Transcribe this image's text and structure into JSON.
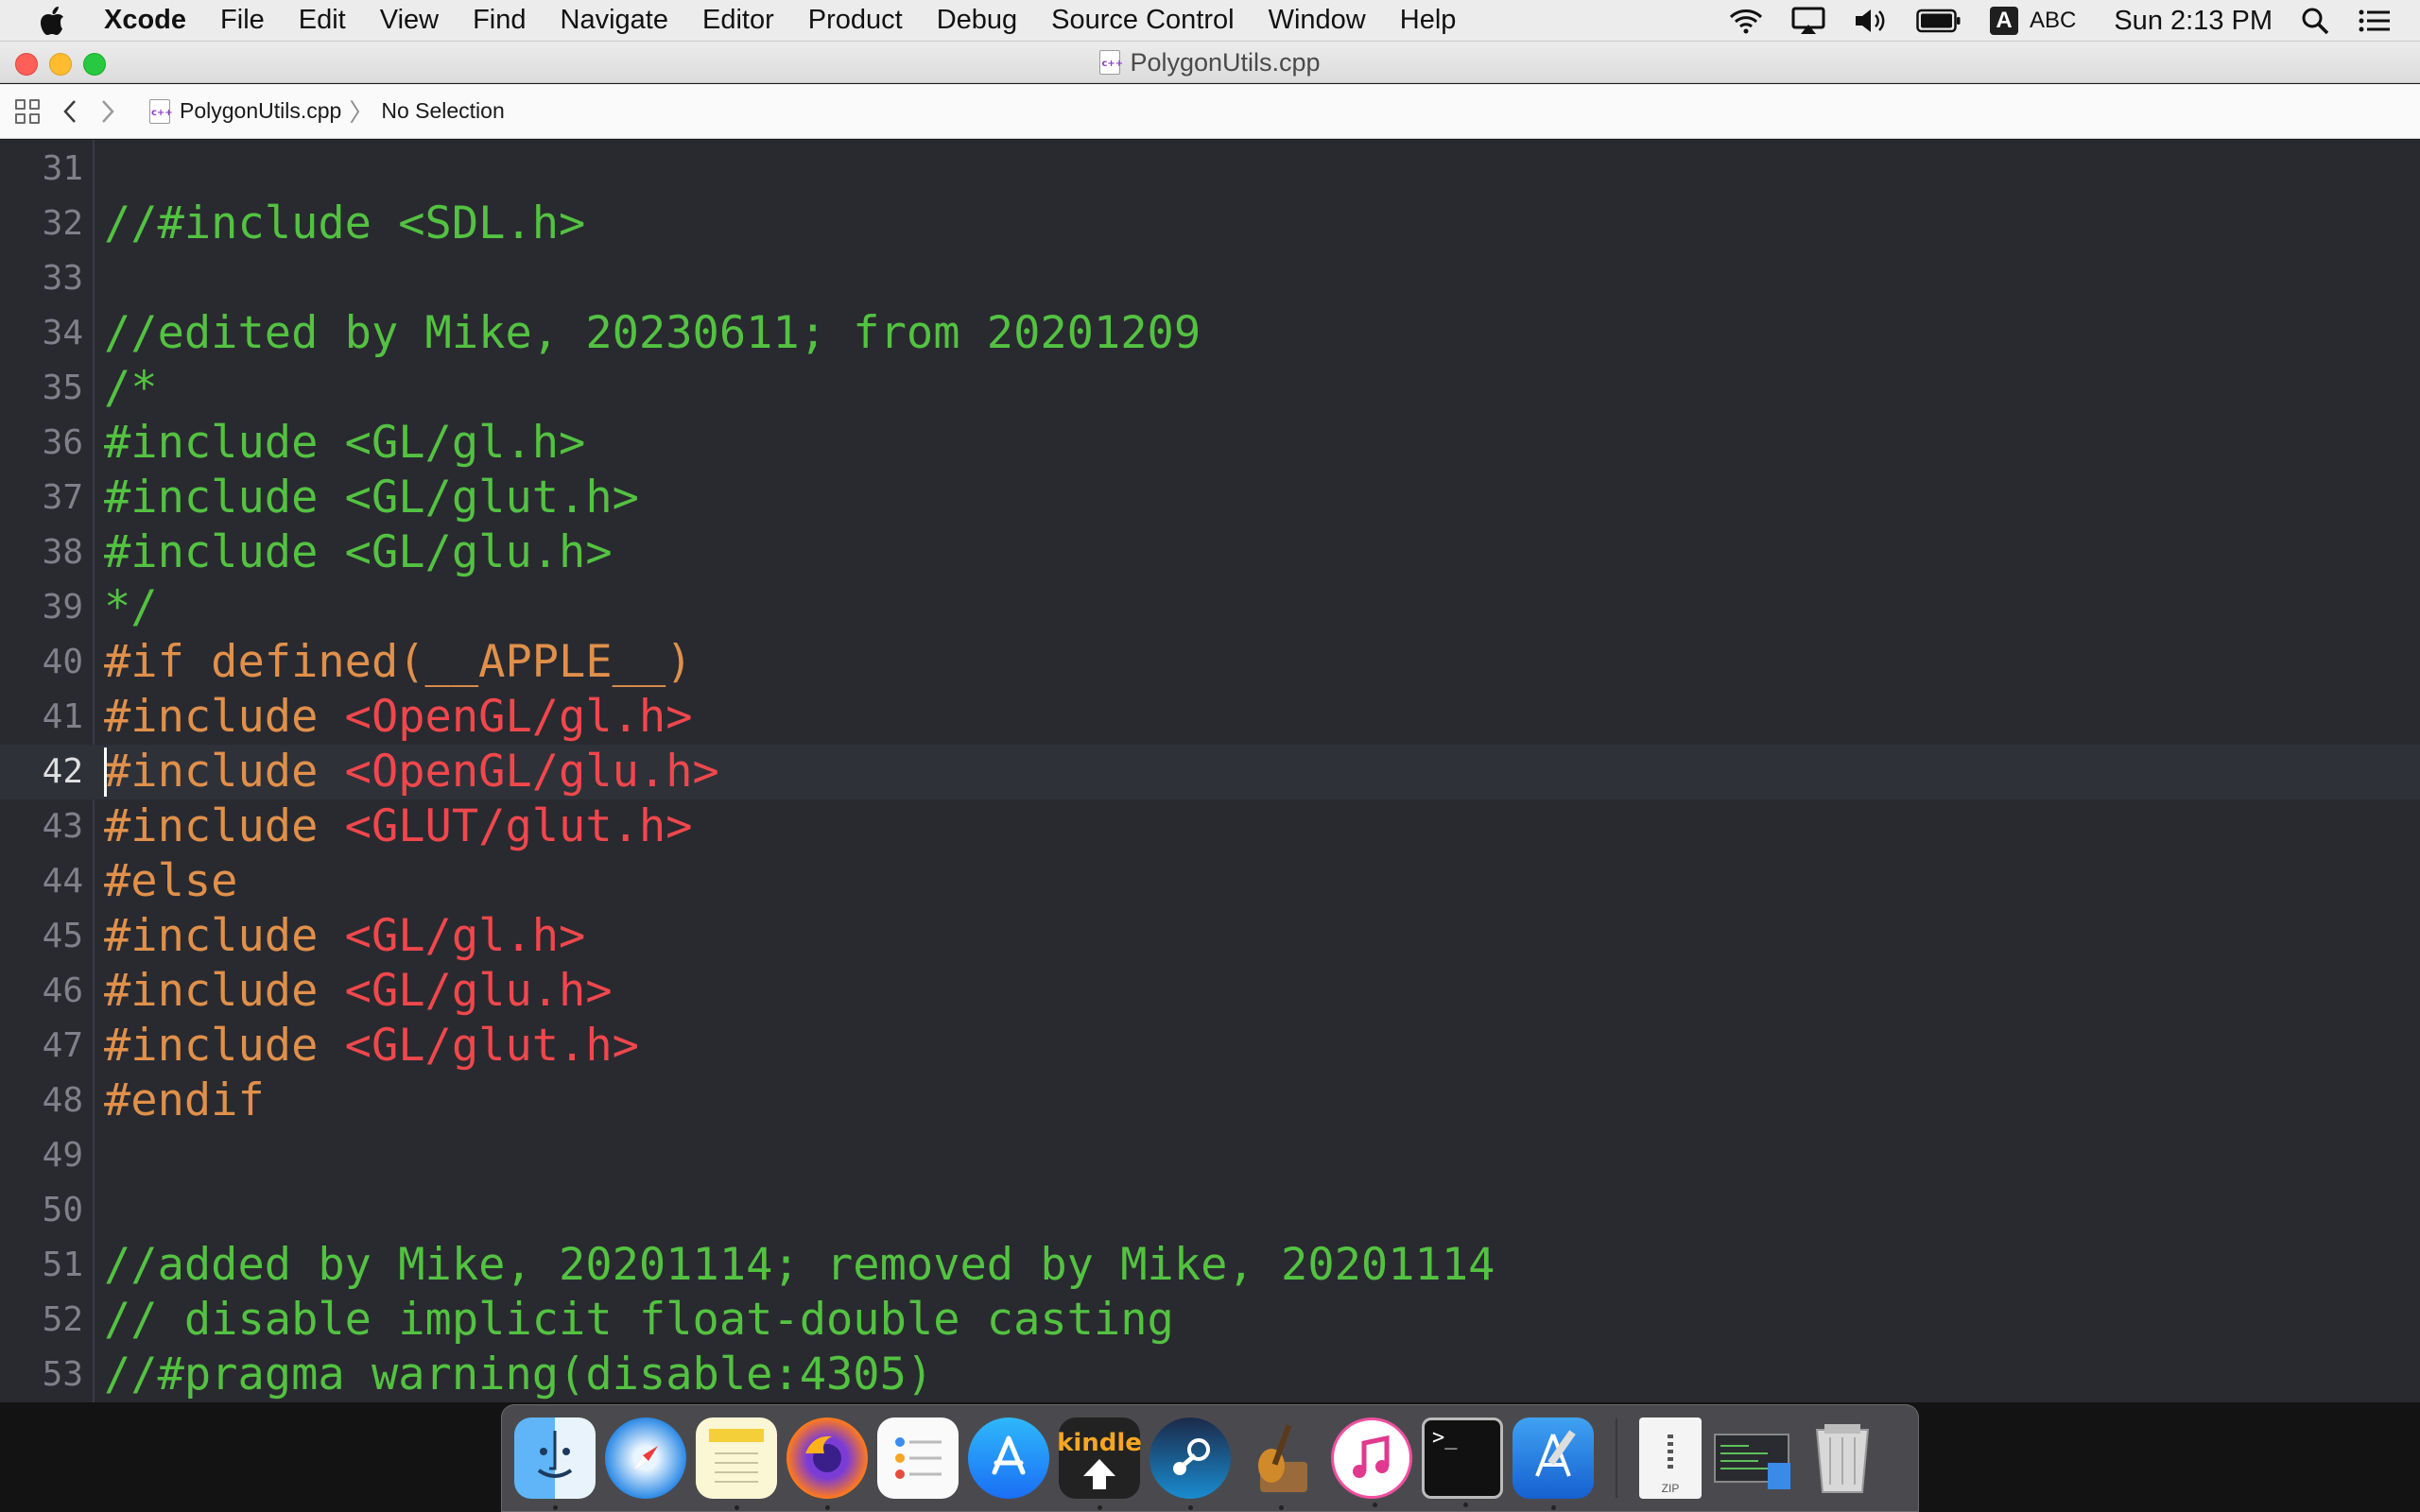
{
  "menubar": {
    "app_name": "Xcode",
    "items": [
      "File",
      "Edit",
      "View",
      "Find",
      "Navigate",
      "Editor",
      "Product",
      "Debug",
      "Source Control",
      "Window",
      "Help"
    ],
    "input_source_badge": "A",
    "input_source_label": "ABC",
    "clock": "Sun 2:13 PM"
  },
  "window": {
    "title": "PolygonUtils.cpp"
  },
  "jumpbar": {
    "file": "PolygonUtils.cpp",
    "selection": "No Selection"
  },
  "editor": {
    "current_line": "42",
    "lines": [
      {
        "num": "31",
        "segments": []
      },
      {
        "num": "32",
        "segments": [
          {
            "t": "//#include <SDL.h>",
            "k": "comment"
          }
        ]
      },
      {
        "num": "33",
        "segments": []
      },
      {
        "num": "34",
        "segments": [
          {
            "t": "//edited by Mike, 20230611; from 20201209",
            "k": "comment"
          }
        ]
      },
      {
        "num": "35",
        "segments": [
          {
            "t": "/*",
            "k": "comment"
          }
        ]
      },
      {
        "num": "36",
        "segments": [
          {
            "t": "#include <GL/gl.h>",
            "k": "comment"
          }
        ]
      },
      {
        "num": "37",
        "segments": [
          {
            "t": "#include <GL/glut.h>",
            "k": "comment"
          }
        ]
      },
      {
        "num": "38",
        "segments": [
          {
            "t": "#include <GL/glu.h>",
            "k": "comment"
          }
        ]
      },
      {
        "num": "39",
        "segments": [
          {
            "t": "*/",
            "k": "comment"
          }
        ]
      },
      {
        "num": "40",
        "segments": [
          {
            "t": "#if defined(__APPLE__)",
            "k": "pp"
          }
        ]
      },
      {
        "num": "41",
        "segments": [
          {
            "t": "#include ",
            "k": "pp"
          },
          {
            "t": "<OpenGL/gl.h>",
            "k": "str"
          }
        ]
      },
      {
        "num": "42",
        "segments": [
          {
            "t": "#include ",
            "k": "pp"
          },
          {
            "t": "<OpenGL/glu.h>",
            "k": "str"
          }
        ]
      },
      {
        "num": "43",
        "segments": [
          {
            "t": "#include ",
            "k": "pp"
          },
          {
            "t": "<GLUT/glut.h>",
            "k": "str"
          }
        ]
      },
      {
        "num": "44",
        "segments": [
          {
            "t": "#else",
            "k": "pp"
          }
        ]
      },
      {
        "num": "45",
        "segments": [
          {
            "t": "#include ",
            "k": "pp"
          },
          {
            "t": "<GL/gl.h>",
            "k": "str"
          }
        ]
      },
      {
        "num": "46",
        "segments": [
          {
            "t": "#include ",
            "k": "pp"
          },
          {
            "t": "<GL/glu.h>",
            "k": "str"
          }
        ]
      },
      {
        "num": "47",
        "segments": [
          {
            "t": "#include ",
            "k": "pp"
          },
          {
            "t": "<GL/glut.h>",
            "k": "str"
          }
        ]
      },
      {
        "num": "48",
        "segments": [
          {
            "t": "#endif",
            "k": "pp"
          }
        ]
      },
      {
        "num": "49",
        "segments": []
      },
      {
        "num": "50",
        "segments": []
      },
      {
        "num": "51",
        "segments": [
          {
            "t": "//added by Mike, 20201114; removed by Mike, 20201114",
            "k": "comment"
          }
        ]
      },
      {
        "num": "52",
        "segments": [
          {
            "t": "// disable implicit float-double casting",
            "k": "comment"
          }
        ]
      },
      {
        "num": "53",
        "segments": [
          {
            "t": "//#pragma warning(disable:4305)",
            "k": "comment"
          }
        ]
      }
    ]
  },
  "dock": {
    "apps": [
      {
        "icon": "finder-icon",
        "running": true
      },
      {
        "icon": "safari-icon",
        "running": false
      },
      {
        "icon": "notes-icon",
        "running": true
      },
      {
        "icon": "firefox-icon",
        "running": true
      },
      {
        "icon": "reminders-icon",
        "running": false
      },
      {
        "icon": "app-store-icon",
        "running": false
      },
      {
        "icon": "kindle-icon",
        "label": "kindle",
        "running": true
      },
      {
        "icon": "steam-icon",
        "running": true
      },
      {
        "icon": "garageband-icon",
        "running": true
      },
      {
        "icon": "itunes-icon",
        "running": true
      },
      {
        "icon": "terminal-icon",
        "running": true
      },
      {
        "icon": "xcode-icon",
        "running": true
      }
    ],
    "stack_items": [
      {
        "icon": "zip-archive-icon",
        "label": "ZIP"
      },
      {
        "icon": "screenshot-stack-icon"
      },
      {
        "icon": "trash-icon"
      }
    ]
  },
  "colors": {
    "editor_bg": "#292a30",
    "comment": "#53c241",
    "preprocessor": "#e0904a",
    "string": "#f0474c",
    "line_number": "#7f8089",
    "current_line_bg": "#2f3139"
  }
}
